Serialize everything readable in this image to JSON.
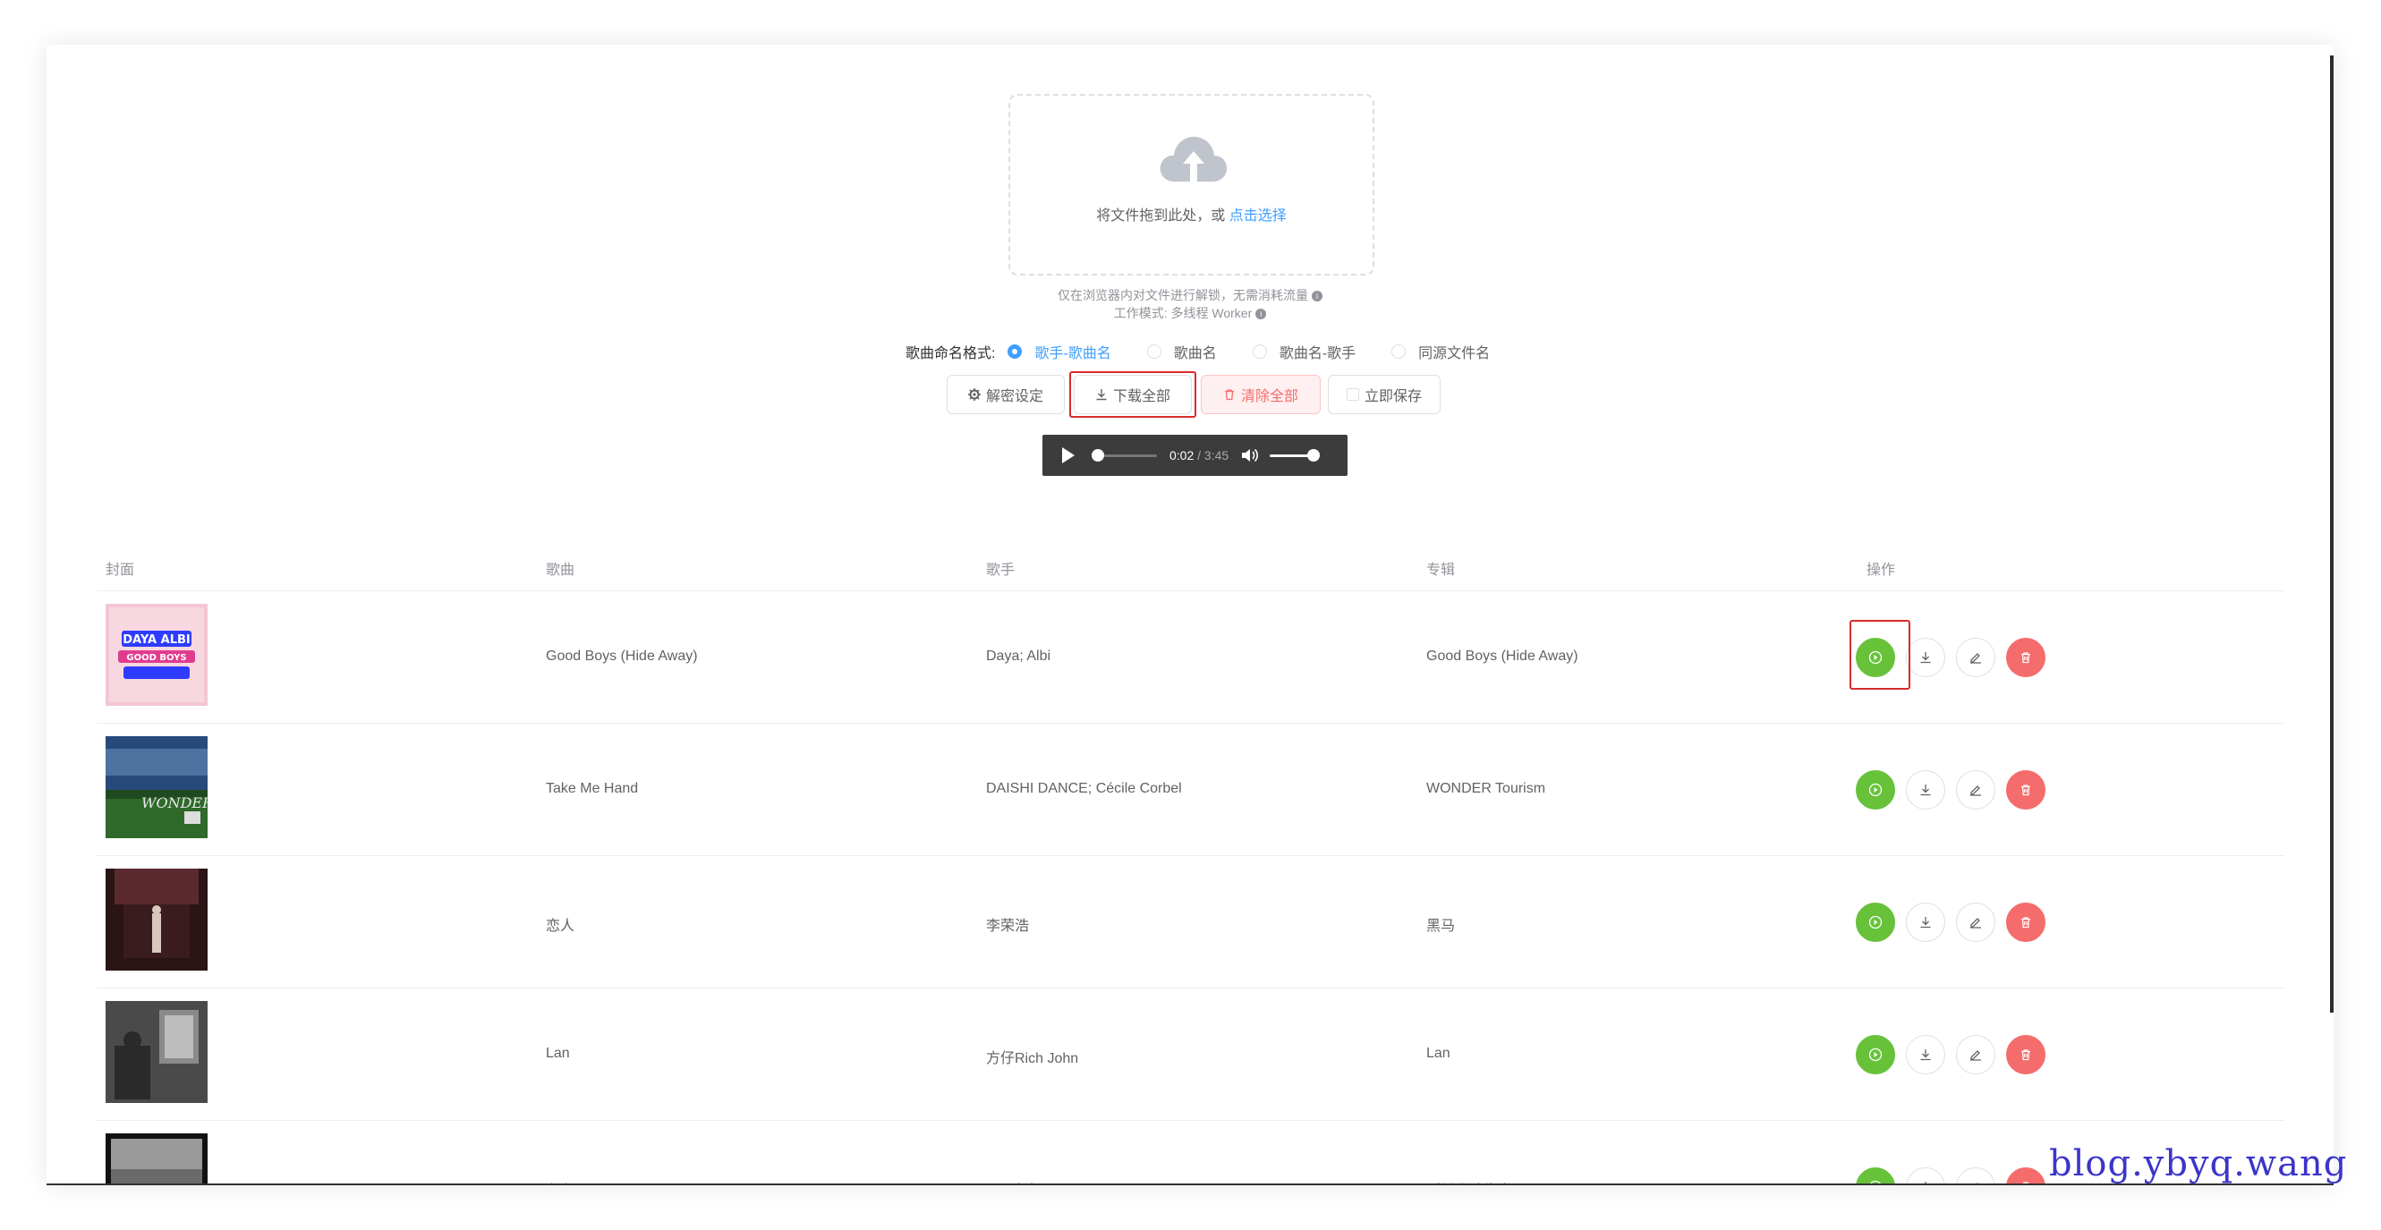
{
  "upload": {
    "drop_text": "将文件拖到此处，或 ",
    "select_link": "点击选择",
    "tip_local": "仅在浏览器内对文件进行解锁，无需消耗流量",
    "tip_mode": "工作模式: 多线程 Worker"
  },
  "naming": {
    "label": "歌曲命名格式:",
    "options": [
      "歌手-歌曲名",
      "歌曲名",
      "歌曲名-歌手",
      "同源文件名"
    ],
    "selected": "歌手-歌曲名"
  },
  "buttons": {
    "settings": "解密设定",
    "download_all": "下载全部",
    "clear_all": "清除全部",
    "save_now": "立即保存"
  },
  "player": {
    "current": "0:02",
    "separator": " / ",
    "total": "3:45",
    "progress": 0.01,
    "volume": 1.0
  },
  "table": {
    "headers": [
      "封面",
      "歌曲",
      "歌手",
      "专辑",
      "操作"
    ],
    "rows": [
      {
        "title": "Good Boys (Hide Away)",
        "artist": "Daya; Albi",
        "album": "Good Boys (Hide Away)",
        "cover_text": "DAYA ALBI GOOD BOYS"
      },
      {
        "title": "Take Me Hand",
        "artist": "DAISHI DANCE; Cécile Corbel",
        "album": "WONDER Tourism",
        "cover_text": "WONDER"
      },
      {
        "title": "恋人",
        "artist": "李荣浩",
        "album": "黑马",
        "cover_text": ""
      },
      {
        "title": "Lan",
        "artist": "方仔Rich John",
        "album": "Lan",
        "cover_text": ""
      },
      {
        "title": "存在",
        "artist": "原子邦妮",
        "album": "孤单会消失离开不见",
        "cover_text": ""
      }
    ]
  },
  "watermark": "blog.ybyq.wang",
  "colors": {
    "primary": "#409eff",
    "success": "#67c23a",
    "danger": "#f56c6c",
    "highlight": "#d92b2b"
  }
}
